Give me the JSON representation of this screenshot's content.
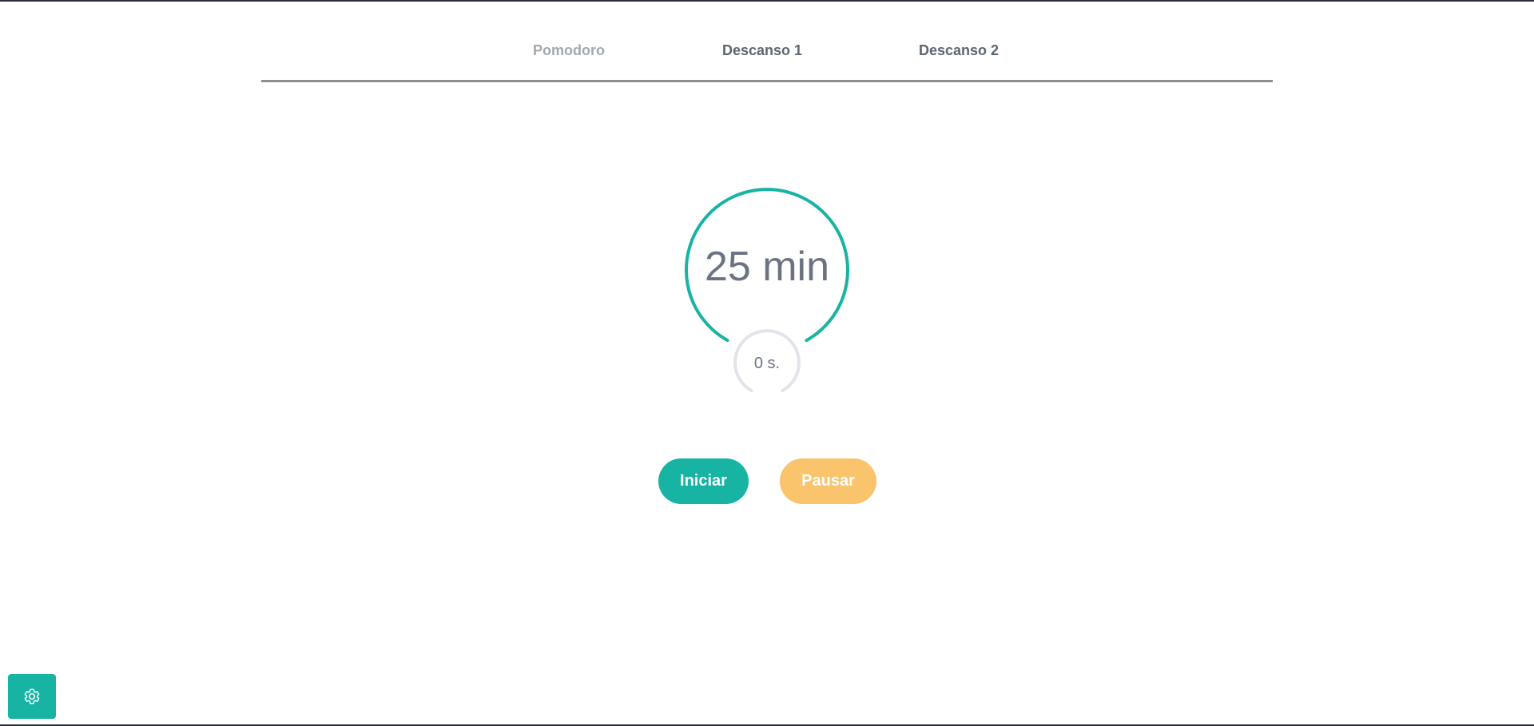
{
  "tabs": [
    {
      "label": "Pomodoro"
    },
    {
      "label": "Descanso 1"
    },
    {
      "label": "Descanso 2"
    }
  ],
  "timer": {
    "minutes_label": "25 min",
    "seconds_label": "0 s."
  },
  "controls": {
    "start_label": "Iniciar",
    "pause_label": "Pausar"
  },
  "colors": {
    "accent": "#17b3a3",
    "pause": "#f9c46b",
    "text": "#6b7380",
    "track": "#e1e4e8"
  },
  "icons": {
    "settings": "gear-icon"
  }
}
